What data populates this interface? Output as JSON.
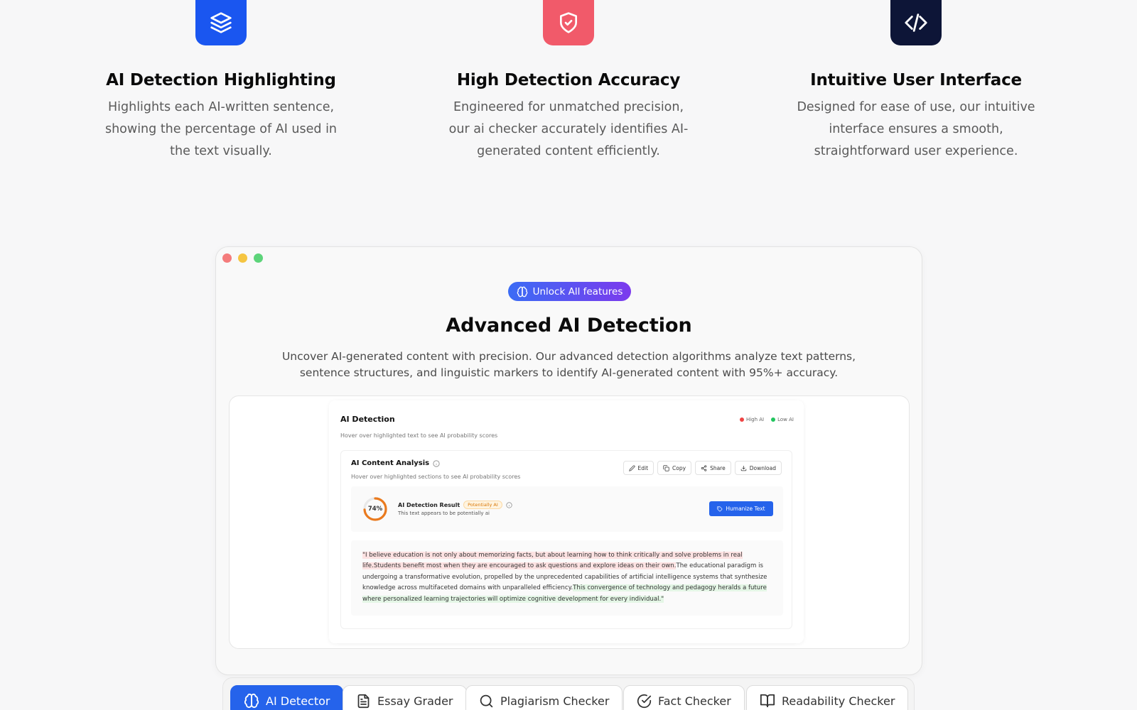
{
  "features": [
    {
      "icon": "layers-icon",
      "color": "#1a56f0",
      "title": "AI Detection Highlighting",
      "description": "Highlights each AI-written sentence, showing the percentage of AI used in the text visually."
    },
    {
      "icon": "shield-check-icon",
      "color": "#f15a6a",
      "title": "High Detection Accuracy",
      "description": "Engineered for unmatched precision, our ai checker accurately identifies AI-generated content efficiently."
    },
    {
      "icon": "code-icon",
      "color": "#0d1537",
      "title": "Intuitive User Interface",
      "description": "Designed for ease of use, our intuitive interface ensures a smooth, straightforward user experience."
    }
  ],
  "showcase": {
    "unlock_label": "Unlock All features",
    "title": "Advanced AI Detection",
    "description": "Uncover AI-generated content with precision. Our advanced detection algorithms analyze text patterns, sentence structures, and linguistic markers to identify AI-generated content with 95%+ accuracy."
  },
  "app": {
    "title": "AI Detection",
    "subtitle": "Hover over highlighted text to see AI probability scores",
    "legend": [
      {
        "label": "High AI",
        "color": "#ef4444"
      },
      {
        "label": "Low AI",
        "color": "#22c55e"
      }
    ],
    "card": {
      "title": "AI Content Analysis",
      "subtitle": "Hover over highlighted sections to see AI probability scores",
      "actions": [
        "Edit",
        "Copy",
        "Share",
        "Download"
      ]
    },
    "result": {
      "percent_label": "74%",
      "percent": 74,
      "title": "AI Detection Result",
      "badge": "Potentially AI",
      "subtitle": "This text appears to be potentially ai",
      "humanize_label": "Humanize Text"
    },
    "text_segments": [
      {
        "text": "\"I believe education is not only about memorizing facts, but about learning how to think critically and solve problems in real life.",
        "level": "high"
      },
      {
        "text": "Students benefit most when they are encouraged to ask questions and explore ideas on their own.",
        "level": "high"
      },
      {
        "text": "The educational paradigm is undergoing a transformative evolution, propelled by the unprecedented capabilities of artificial intelligence systems that synthesize knowledge across multifaceted domains with unparalleled efficiency.",
        "level": "none"
      },
      {
        "text": "This convergence of technology and pedagogy heralds a future where personalized learning trajectories will optimize cognitive development for every individual.\"",
        "level": "low"
      }
    ]
  },
  "tabs": [
    {
      "label": "AI Detector",
      "icon": "brain-icon",
      "active": true
    },
    {
      "label": "Essay Grader",
      "icon": "document-icon",
      "active": false
    },
    {
      "label": "Plagiarism Checker",
      "icon": "search-icon",
      "active": false
    },
    {
      "label": "Fact Checker",
      "icon": "check-circle-icon",
      "active": false
    },
    {
      "label": "Readability Checker",
      "icon": "book-icon",
      "active": false
    }
  ]
}
